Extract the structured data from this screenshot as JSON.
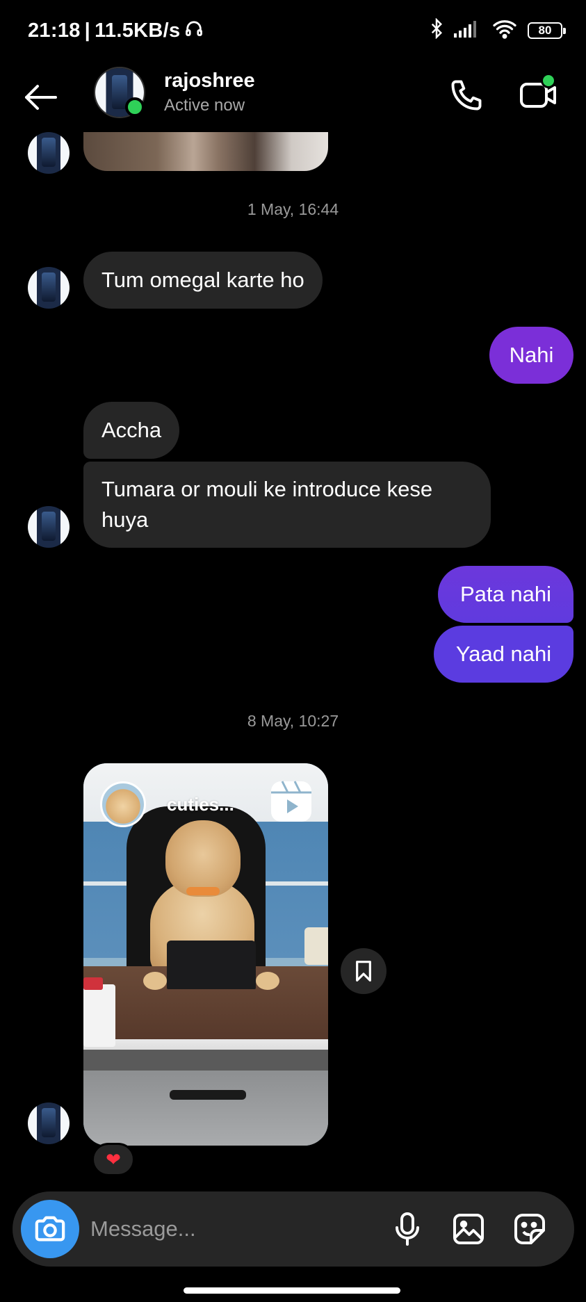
{
  "status_bar": {
    "time": "21:18",
    "separator": "|",
    "network_speed": "11.5KB/s",
    "battery": "80",
    "icons": [
      "headphones-icon",
      "bluetooth-icon",
      "signal-icon",
      "wifi-icon",
      "battery-icon"
    ]
  },
  "header": {
    "name": "rajoshree",
    "status": "Active now",
    "icons": [
      "back-arrow-icon",
      "phone-icon",
      "video-call-icon"
    ]
  },
  "conversation": {
    "timestamps": [
      "1 May, 16:44",
      "8 May, 10:27"
    ],
    "messages": [
      {
        "sender": "them",
        "text": "Tum omegal karte ho"
      },
      {
        "sender": "me",
        "text": "Nahi"
      },
      {
        "sender": "them",
        "text": "Accha"
      },
      {
        "sender": "them",
        "text": "Tumara or mouli ke introduce kese huya"
      },
      {
        "sender": "me",
        "text": "Pata nahi"
      },
      {
        "sender": "me",
        "text": "Yaad nahi"
      }
    ],
    "reel": {
      "username": "cuties...",
      "icon": "reels-icon",
      "reaction": "❤"
    }
  },
  "colors": {
    "incoming_bubble": "#262626",
    "outgoing_purple": "#7b2fd8",
    "outgoing_indigo": "#5b3ce0",
    "online": "#2fd158",
    "camera_button": "#3897f0"
  },
  "composer": {
    "placeholder": "Message...",
    "icons": [
      "camera-icon",
      "microphone-icon",
      "gallery-icon",
      "sticker-icon"
    ]
  }
}
